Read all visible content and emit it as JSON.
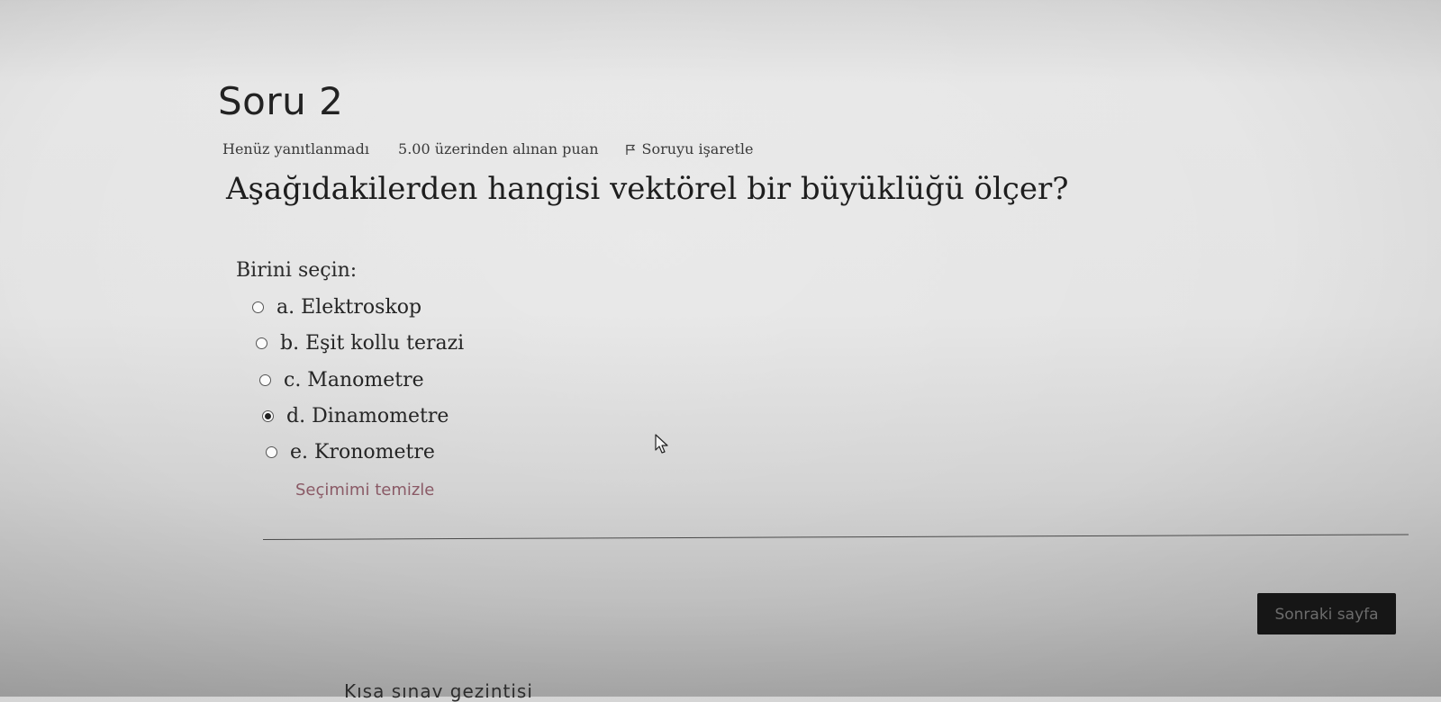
{
  "question": {
    "title": "Soru 2",
    "state": "Henüz yanıtlanmadı",
    "grade": "5.00 üzerinden alınan puan",
    "flag_label": "Soruyu işaretle",
    "text": "Aşağıdakilerden hangisi vektörel bir büyüklüğü ölçer?"
  },
  "answers": {
    "prompt": "Birini seçin:",
    "options": [
      {
        "label": "a. Elektroskop",
        "selected": false
      },
      {
        "label": "b. Eşit kollu terazi",
        "selected": false
      },
      {
        "label": "c. Manometre",
        "selected": false
      },
      {
        "label": "d. Dinamometre",
        "selected": true
      },
      {
        "label": "e. Kronometre",
        "selected": false
      }
    ],
    "clear_label": "Seçimimi temizle"
  },
  "navigation": {
    "next_label": "Sonraki sayfa",
    "quiz_nav_title": "Kısa sınav gezintisi"
  },
  "icons": {
    "flag": "flag-icon",
    "radio": "radio-icon",
    "cursor": "mouse-cursor-icon"
  },
  "colors": {
    "clear_link": "#8a5a66",
    "next_button_bg": "#161616",
    "next_button_text": "#6c6c6c"
  }
}
